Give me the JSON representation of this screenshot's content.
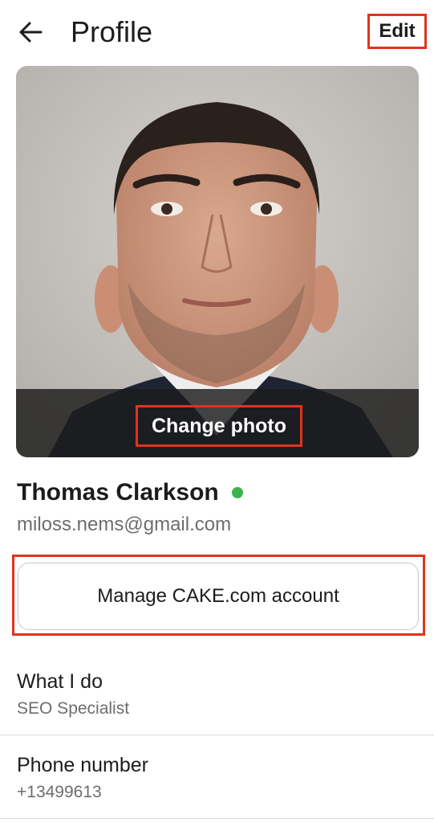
{
  "header": {
    "title": "Profile",
    "edit_label": "Edit",
    "back_icon": "arrow-left-icon"
  },
  "photo": {
    "change_label": "Change photo"
  },
  "user": {
    "name": "Thomas Clarkson",
    "email": "miloss.nems@gmail.com",
    "status_color": "#3bb54a"
  },
  "actions": {
    "manage_label": "Manage CAKE.com account"
  },
  "details": [
    {
      "label": "What I do",
      "value": "SEO Specialist"
    },
    {
      "label": "Phone number",
      "value": "+13499613"
    }
  ],
  "colors": {
    "highlight": "#e0341d",
    "text_primary": "#1c1c1c",
    "text_secondary": "#6d6d6d"
  }
}
